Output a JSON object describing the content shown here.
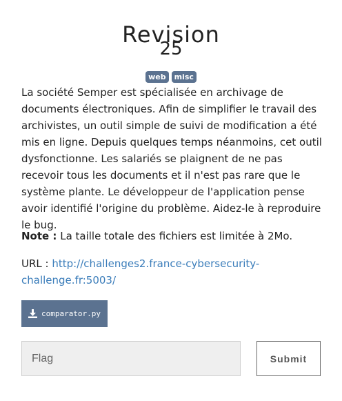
{
  "challenge": {
    "title": "Revision",
    "value": "25",
    "tags": [
      "web",
      "misc"
    ],
    "description": "La société Semper est spécialisée en archivage de documents électroniques. Afin de simplifier le travail des archivistes, un outil simple de suivi de modification a été mis en ligne. Depuis quelques temps néanmoins, cet outil dysfonctionne. Les salariés se plaignent de ne pas recevoir tous les documents et il n'est pas rare que le système plante. Le développeur de l'application pense avoir identifié l'origine du problème. Aidez-le à reproduire le bug.",
    "note_label": "Note :",
    "note_text": " La taille totale des fichiers est limitée à 2Mo.",
    "url_label": "URL : ",
    "url": "http://challenges2.france-cybersecurity-challenge.fr:5003/"
  },
  "file": {
    "name": "comparator.py",
    "icon": "download-icon"
  },
  "form": {
    "flag_placeholder": "Flag",
    "flag_value": "",
    "submit_label": "Submit"
  },
  "colors": {
    "tag_bg": "#5b7290",
    "link": "#3b7dba",
    "button_bg": "#5b7290"
  }
}
